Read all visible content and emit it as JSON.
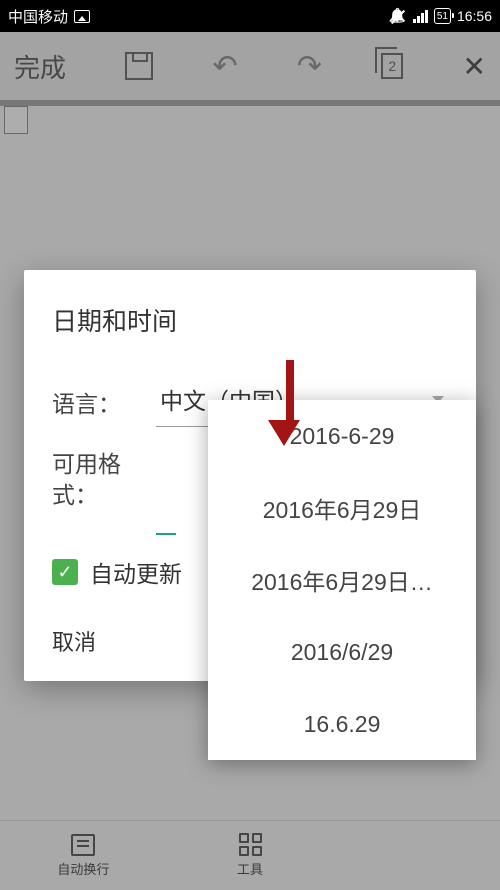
{
  "status": {
    "carrier": "中国移动",
    "battery": "51",
    "time": "16:56"
  },
  "toolbar": {
    "done": "完成",
    "copy_count": "2"
  },
  "dialog": {
    "title": "日期和时间",
    "language_label": "语言：",
    "language_value": "中文（中国）",
    "format_label": "可用格式：",
    "auto_update_label": "自动更新",
    "cancel": "取消"
  },
  "dropdown": {
    "options": [
      "2016-6-29",
      "2016年6月29日",
      "2016年6月29日…",
      "2016/6/29",
      "16.6.29"
    ]
  },
  "bottom": {
    "wrap": "自动换行",
    "tools": "工具"
  }
}
